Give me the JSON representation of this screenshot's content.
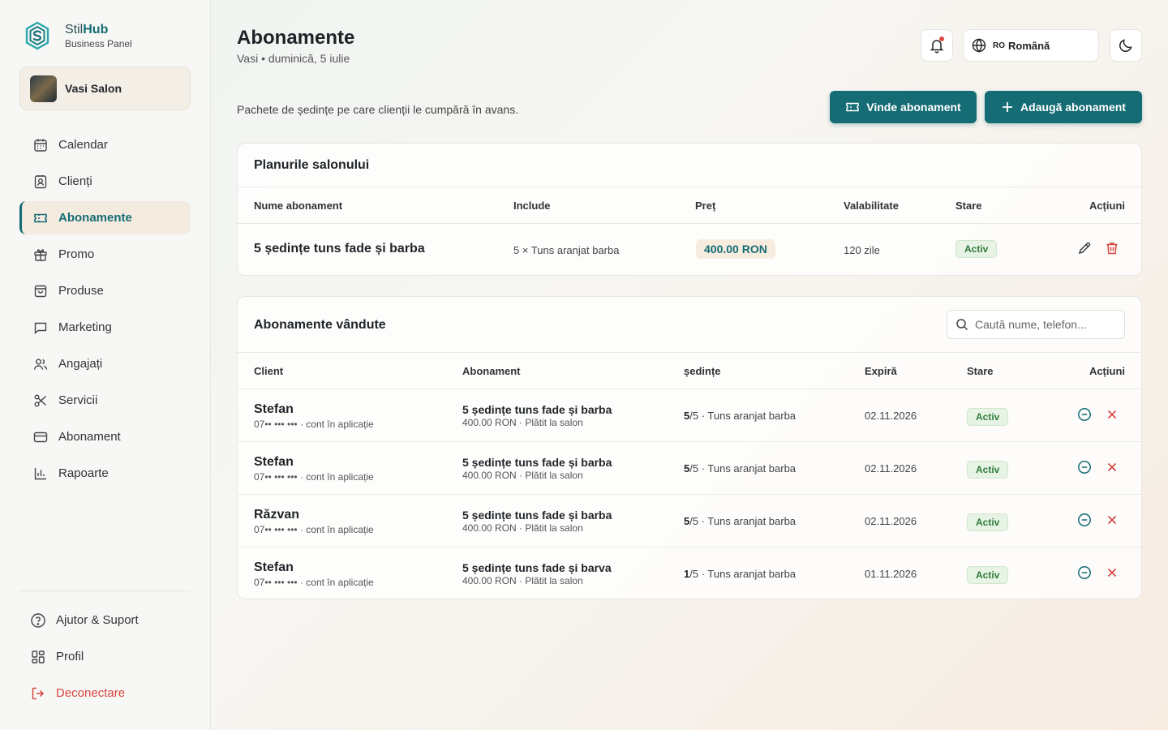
{
  "brand": {
    "name_a": "Stil",
    "name_b": "Hub",
    "subtitle": "Business Panel"
  },
  "salon": {
    "name": "Vasi Salon"
  },
  "nav": [
    {
      "label": "Calendar",
      "icon": "calendar-icon"
    },
    {
      "label": "Clienți",
      "icon": "contact-card-icon"
    },
    {
      "label": "Abonamente",
      "icon": "ticket-icon",
      "active": true
    },
    {
      "label": "Promo",
      "icon": "gift-icon"
    },
    {
      "label": "Produse",
      "icon": "shopping-bag-icon"
    },
    {
      "label": "Marketing",
      "icon": "message-icon"
    },
    {
      "label": "Angajați",
      "icon": "users-icon"
    },
    {
      "label": "Servicii",
      "icon": "scissors-icon"
    },
    {
      "label": "Abonament",
      "icon": "credit-card-icon"
    },
    {
      "label": "Rapoarte",
      "icon": "bar-chart-icon"
    }
  ],
  "bottom_nav": {
    "help": "Ajutor & Suport",
    "profile": "Profil",
    "logout": "Deconectare"
  },
  "header": {
    "title": "Abonamente",
    "subtitle": "Vasi • duminică, 5 iulie",
    "lang_code": "RO",
    "lang_label": "Română",
    "description": "Pachete de ședințe pe care clienții le cumpără în avans.",
    "sell_button": "Vinde abonament",
    "add_button": "Adaugă abonament"
  },
  "colors": {
    "accent": "#156c74",
    "danger": "#d9443d",
    "success_badge": "#e7f4e5"
  },
  "plans": {
    "title": "Planurile salonului",
    "columns": [
      "Nume abonament",
      "Include",
      "Preț",
      "Valabilitate",
      "Stare",
      "Acțiuni"
    ],
    "rows": [
      {
        "name": "5 ședințe tuns fade și barba",
        "includes": "5 × Tuns aranjat barba",
        "price": "400.00 RON",
        "validity": "120 zile",
        "status": "Activ"
      }
    ]
  },
  "sold": {
    "title": "Abonamente vândute",
    "search_placeholder": "Caută nume, telefon...",
    "columns": [
      "Client",
      "Abonament",
      "ședințe",
      "Expiră",
      "Stare",
      "Acțiuni"
    ],
    "rows": [
      {
        "client": "Stefan",
        "client_sub": "07•• ••• ••• · cont în aplicație",
        "sub_name": "5 ședințe tuns fade și barba",
        "sub_detail": "400.00 RON · Plătit la salon",
        "sessions_count": "5",
        "sessions_total": "/5",
        "sessions_service": " · Tuns aranjat barba",
        "expires": "02.11.2026",
        "status": "Activ"
      },
      {
        "client": "Stefan",
        "client_sub": "07•• ••• ••• · cont în aplicație",
        "sub_name": "5 ședințe tuns fade și barba",
        "sub_detail": "400.00 RON · Plătit la salon",
        "sessions_count": "5",
        "sessions_total": "/5",
        "sessions_service": " · Tuns aranjat barba",
        "expires": "02.11.2026",
        "status": "Activ"
      },
      {
        "client": "Răzvan",
        "client_sub": "07•• ••• ••• · cont în aplicație",
        "sub_name": "5 ședințe tuns fade și barba",
        "sub_detail": "400.00 RON · Plătit la salon",
        "sessions_count": "5",
        "sessions_total": "/5",
        "sessions_service": " · Tuns aranjat barba",
        "expires": "02.11.2026",
        "status": "Activ"
      },
      {
        "client": "Stefan",
        "client_sub": "07•• ••• ••• · cont în aplicație",
        "sub_name": "5 ședințe tuns fade și barva",
        "sub_detail": "400.00 RON · Plătit la salon",
        "sessions_count": "1",
        "sessions_total": "/5",
        "sessions_service": " · Tuns aranjat barba",
        "expires": "01.11.2026",
        "status": "Activ"
      }
    ]
  }
}
